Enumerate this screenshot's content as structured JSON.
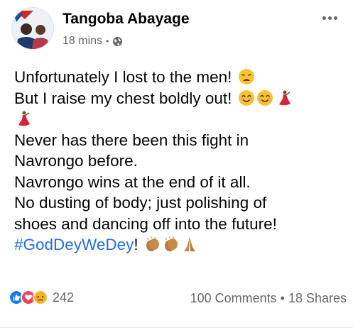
{
  "post": {
    "author": "Tangoba Abayage",
    "timestamp": "18 mins",
    "privacy_icon": "globe-icon",
    "lines": [
      "Unfortunately I lost to the men!",
      "But I raise my chest boldly out!",
      "",
      "Never has there been this fight in",
      "Navrongo before.",
      "Navrongo wins at the end of it all.",
      "No dusting of body; just polishing of",
      "shoes and dancing off into the future!"
    ],
    "hashtag": "#GodDeyWeDey",
    "hashtag_suffix": "!",
    "emojis": [
      "weary-face",
      "smiling-face",
      "smiling-face",
      "dancer",
      "dancer",
      "clapping-hands",
      "clapping-hands",
      "folded-hands"
    ]
  },
  "reactions": {
    "types": [
      "like",
      "love",
      "sad"
    ],
    "count": "242",
    "comments": "100 Comments",
    "separator": "•",
    "shares": "18 Shares"
  },
  "colors": {
    "hashtag": "#216fdb",
    "secondary_text": "#65676b",
    "like_blue": "#1877f2",
    "love_red": "#f33e58",
    "sad_yellow": "#f7b125"
  }
}
